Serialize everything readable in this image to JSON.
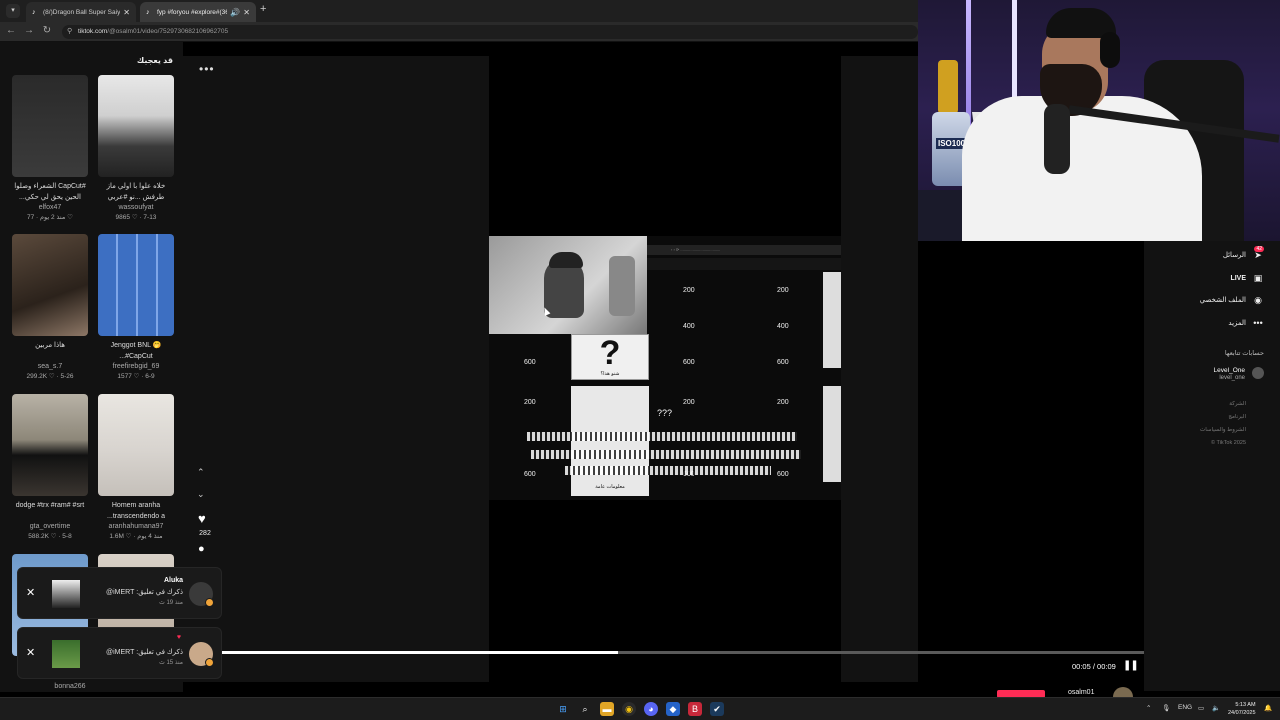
{
  "browser": {
    "tabs": [
      {
        "title": "(8/)Dragon Ball Super Saiyan A",
        "icon": "tiktok-icon"
      },
      {
        "title": "fyp #foryou #explore#(36)",
        "icon": "tiktok-icon",
        "active": true
      }
    ],
    "url_host": "tiktok.com",
    "url_path": "/@osalm01/video/7529730682106962705"
  },
  "left_panel": {
    "title": "قد يعجبك",
    "cards": [
      {
        "caption": "#CapCut الشعراء وصلوا الحين يحق لي حكي...",
        "user": "elfox47",
        "meta": "منذ 2 يوم · 77 ♡"
      },
      {
        "caption": "خلاه علوا با اولي ماز طرفش ...نو #عربي",
        "user": "wassoufyat",
        "meta": "9865 ♡ · 7-13"
      },
      {
        "caption": "هاذا مربين",
        "user": "sea_s.7",
        "meta": "299.2K ♡ · 5-26"
      },
      {
        "caption": "Jenggot BNL 🤭 #CapCut...",
        "user": "freefirebgid_69",
        "meta": "1577 ♡ · 6-9"
      },
      {
        "caption": "dodge #trx #ram# #srt",
        "user": "gta_overtime",
        "meta": "588.2K ♡ · 5-8"
      },
      {
        "caption": "Homem aranha transcendendo a...",
        "user": "aranhahumana97",
        "meta": "1.6M ♡ · منذ 4 يوم"
      }
    ],
    "bottom_user": "bonna266"
  },
  "video": {
    "more_label": "•••",
    "grid_values": {
      "r1": [
        "200",
        "200"
      ],
      "r2": [
        "400",
        "400"
      ],
      "r3": [
        "600",
        "600",
        "600"
      ],
      "r4": [
        "200",
        "200",
        "200"
      ],
      "r6": [
        "600",
        "600",
        "600"
      ]
    },
    "question_caption": "شنو هذا؟",
    "question_mark": "?",
    "bottom_caption": "معلومات عامة",
    "qqq": "???",
    "likes": "282",
    "time": "00:05 / 00:09",
    "progress": 0.43
  },
  "notifications": [
    {
      "name": "Aluka",
      "text": "ذكرك في تعليق: iMERT@",
      "time": "منذ 19 ث"
    },
    {
      "name": "",
      "text": "ذكرك في تعليق: iMERT@",
      "time": "منذ 15 ث"
    }
  ],
  "right_panel": {
    "nav": [
      {
        "label": "الرسائل",
        "icon": "messages-icon",
        "badge": "42"
      },
      {
        "label": "LIVE",
        "icon": "live-icon"
      },
      {
        "label": "الملف الشخصي",
        "icon": "profile-icon"
      },
      {
        "label": "المزيد",
        "icon": "more-icon"
      }
    ],
    "following_title": "حسابات تتابعها",
    "account_name": "Level_One",
    "account_handle": "level_one",
    "footer": [
      "الشركة",
      "البرنامج",
      "الشروط والسياسات",
      "TikTok 2025 ©"
    ],
    "bottom_user": "osalm01"
  },
  "taskbar": {
    "lang": "ENG",
    "time": "5:13 AM",
    "date": "24/07/2025"
  },
  "colors": {
    "accent": "#fe2c55",
    "background": "#121212"
  }
}
